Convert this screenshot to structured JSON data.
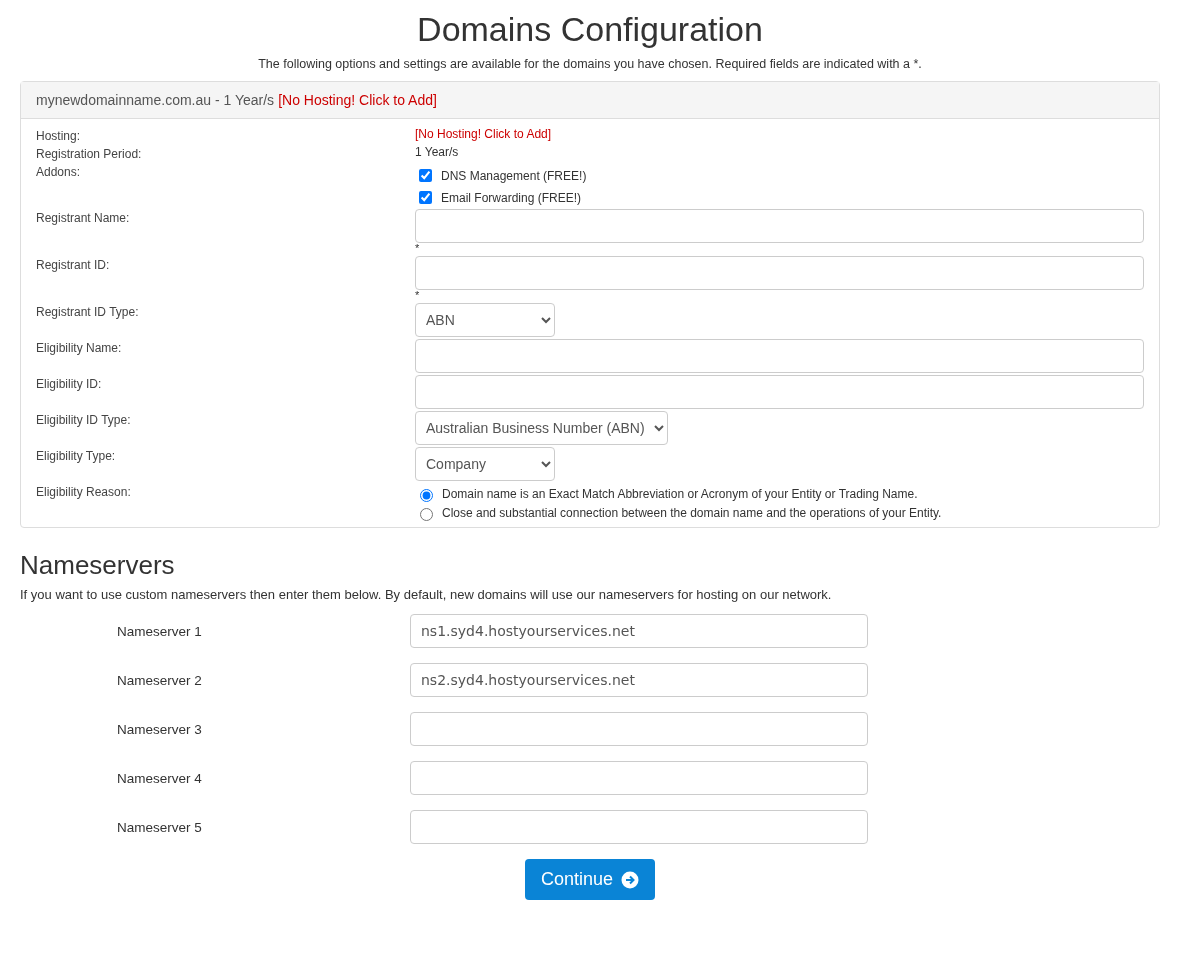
{
  "title": "Domains Configuration",
  "subtitle": "The following options and settings are available for the domains you have chosen. Required fields are indicated with a *.",
  "panel": {
    "header": "mynewdomainname.com.au - 1 Year/s",
    "header_link": "[No Hosting! Click to Add]",
    "rows": [
      {
        "label": "Hosting:",
        "kind": "link",
        "text": "[No Hosting! Click to Add]"
      },
      {
        "label": "Registration Period:",
        "kind": "text",
        "text": "1 Year/s"
      },
      {
        "label": "Addons:",
        "kind": "checkboxes",
        "options": [
          {
            "label": "DNS Management (FREE!)",
            "checked": true
          },
          {
            "label": "Email Forwarding (FREE!)",
            "checked": true
          }
        ]
      },
      {
        "label": "Registrant Name:",
        "kind": "input",
        "note": "*"
      },
      {
        "label": "Registrant ID:",
        "kind": "input",
        "note": "*"
      },
      {
        "label": "Registrant ID Type:",
        "kind": "select",
        "value": "ABN"
      },
      {
        "label": "Eligibility Name:",
        "kind": "input"
      },
      {
        "label": "Eligibility ID:",
        "kind": "input"
      },
      {
        "label": "Eligibility ID Type:",
        "kind": "select",
        "value": "Australian Business Number (ABN)"
      },
      {
        "label": "Eligibility Type:",
        "kind": "select",
        "value": "Company"
      },
      {
        "label": "Eligibility Reason:",
        "kind": "radios",
        "options": [
          {
            "label": "Domain name is an Exact Match Abbreviation or Acronym of your Entity or Trading Name.",
            "selected": true
          },
          {
            "label": "Close and substantial connection between the domain name and the operations of your Entity.",
            "selected": false
          }
        ]
      }
    ]
  },
  "nameservers": {
    "heading": "Nameservers",
    "intro": "If you want to use custom nameservers then enter them below. By default, new domains will use our nameservers for hosting on our network.",
    "fields": [
      {
        "label": "Nameserver 1",
        "value": "ns1.syd4.hostyourservices.net"
      },
      {
        "label": "Nameserver 2",
        "value": "ns2.syd4.hostyourservices.net"
      },
      {
        "label": "Nameserver 3"
      },
      {
        "label": "Nameserver 4"
      },
      {
        "label": "Nameserver 5"
      }
    ]
  },
  "continue_button": "Continue"
}
